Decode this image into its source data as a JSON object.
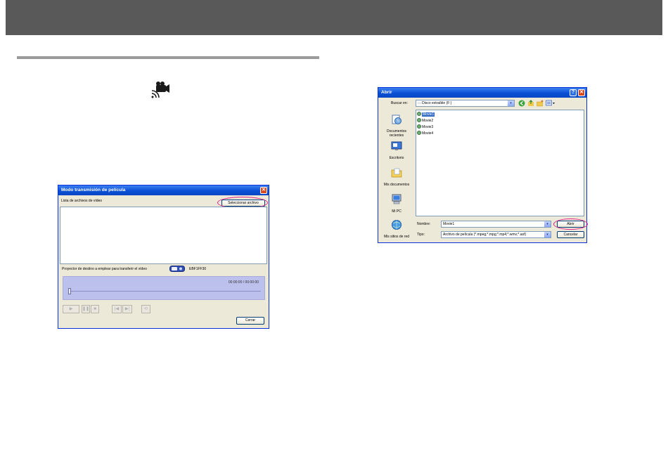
{
  "movie_window": {
    "title": "Modo transmisión de película",
    "list_label": "Lista de archivos de vídeo",
    "select_file_button": "Seleccionar archivo",
    "projector_label": "Proyector de destino a emplear para transferir el vídeo",
    "projector_name": "EBF1FF30",
    "time_display": "00:00:00 / 00:00:00",
    "close_button": "Cerrar",
    "progress": 0,
    "controls": [
      "play-icon",
      "pause-icon",
      "stop-icon",
      "previous-icon",
      "next-icon",
      "repeat-icon"
    ]
  },
  "open_dialog": {
    "title": "Abrir",
    "look_in_label": "Buscar en:",
    "look_in_value": "Disco extraíble (F:)",
    "places": [
      {
        "label": "Documentos recientes",
        "icon": "recent-documents-icon"
      },
      {
        "label": "Escritorio",
        "icon": "desktop-icon"
      },
      {
        "label": "Mis documentos",
        "icon": "my-documents-icon"
      },
      {
        "label": "Mi PC",
        "icon": "my-computer-icon"
      },
      {
        "label": "Mis sitios de red",
        "icon": "network-places-icon"
      }
    ],
    "files": [
      "Movie1",
      "Movie2",
      "Movie3",
      "Movie4"
    ],
    "selected_file": "Movie1",
    "name_label": "Nombre:",
    "name_value": "Movie1",
    "type_label": "Tipo:",
    "type_value": "Archivo de película (*.mpeg;*.mpg;*.mp4;*.wmv;*.asf)",
    "open_button": "Abrir",
    "cancel_button": "Cancelar"
  },
  "colors": {
    "highlight": "#e0268c",
    "titlebar": "#0a4fd6",
    "window_bg": "#ece9d8",
    "header_bar": "#595959"
  }
}
